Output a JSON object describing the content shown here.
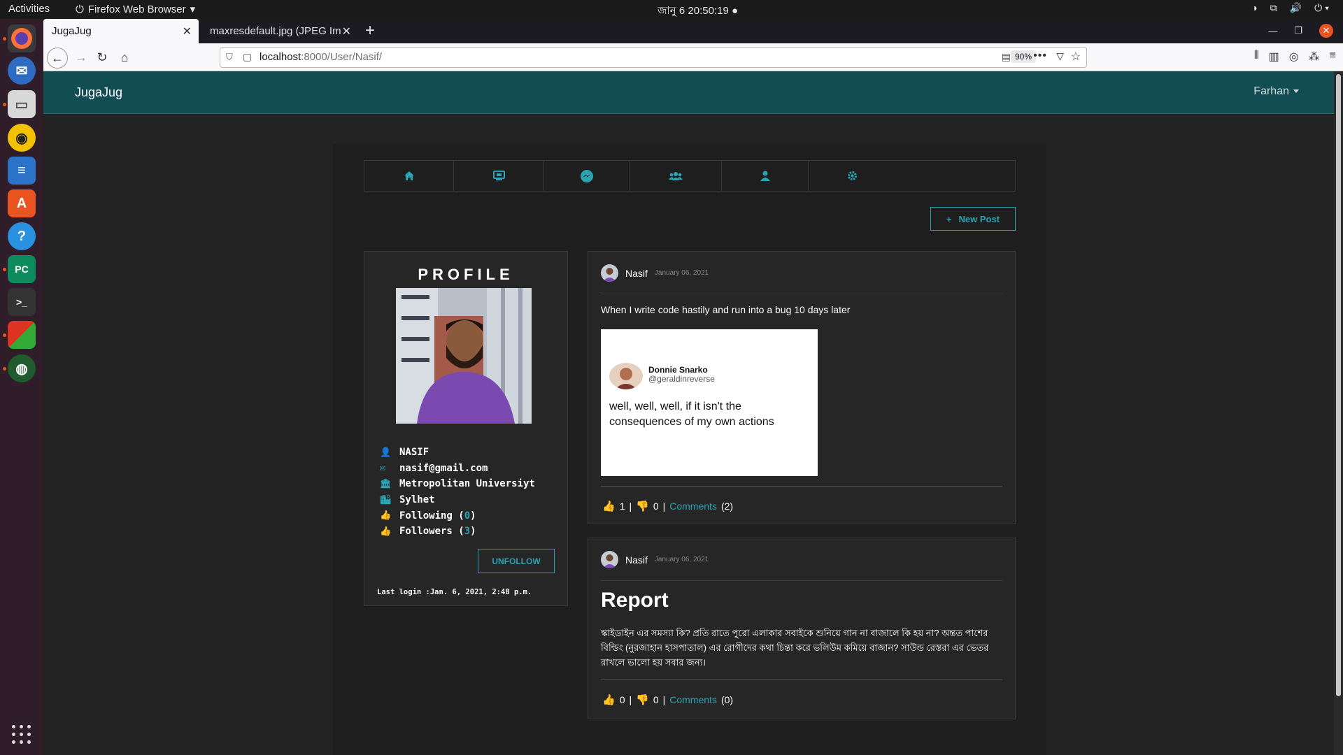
{
  "os": {
    "activities": "Activities",
    "app_menu": "Firefox Web Browser",
    "clock": "জানু 6  20:50:19"
  },
  "browser": {
    "tabs": [
      {
        "label": "JugaJug"
      },
      {
        "label": "maxresdefault.jpg (JPEG Im"
      }
    ],
    "url_host": "localhost",
    "url_path": ":8000/User/Nasif/",
    "zoom": "90%"
  },
  "site": {
    "brand": "JugaJug",
    "user_menu": "Farhan",
    "new_post_label": "New Post",
    "icon_nav": [
      "home-icon",
      "tv-icon",
      "messenger-icon",
      "users-icon",
      "user-icon",
      "gear-icon"
    ]
  },
  "profile": {
    "title": "PROFILE",
    "name": "NASIF",
    "email": "nasif@gmail.com",
    "university": "Metropolitan Universiyt",
    "city": "Sylhet",
    "following_label": "Following (",
    "following_count": "0",
    "followers_label": "Followers (",
    "followers_count": "3",
    "close_paren": ")",
    "unfollow_label": "UNFOLLOW",
    "last_login": "Last login :Jan. 6, 2021, 2:48 p.m."
  },
  "posts": [
    {
      "author": "Nasif",
      "date": "January 06, 2021",
      "text": "When I write code hastily and run into a bug 10 days later",
      "image": {
        "name": "Donnie Snarko",
        "handle": "@geraldinreverse",
        "quote": "well, well, well, if it isn't the consequences of my own actions"
      },
      "likes": "1",
      "dislikes": "0",
      "comments_label": "Comments",
      "comments_count": "(2)",
      "sep1": "|",
      "sep2": "|"
    },
    {
      "author": "Nasif",
      "date": "January 06, 2021",
      "title": "Report",
      "text": "স্কাইডাইন এর সমস্যা কি? প্রতি রাতে পুরো এলাকার সবাইকে শুনিয়ে গান না বাজালে কি হয় না? অন্তত পাশের বিল্ডিং (নুরজাহান হাসপাতাল) এর রোগীদের কথা চিন্তা করে ভলিউম কমিয়ে বাজান? সাউন্ড রেস্তরা এর ভেতর রাখলে ভালো হয় সবার জন্য।",
      "likes": "0",
      "dislikes": "0",
      "comments_label": "Comments",
      "comments_count": "(0)",
      "sep1": "|",
      "sep2": "|"
    }
  ]
}
